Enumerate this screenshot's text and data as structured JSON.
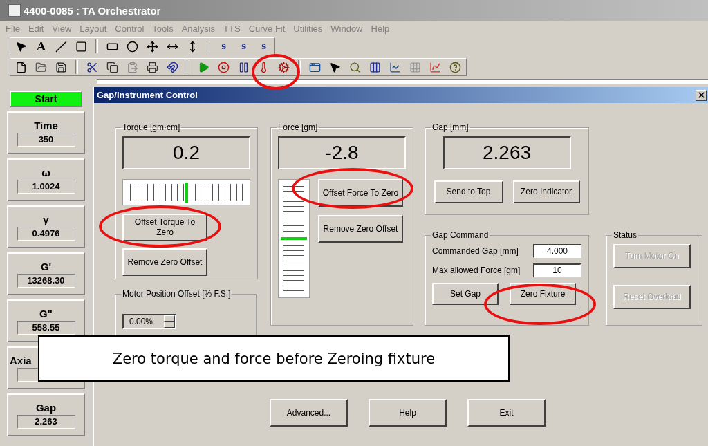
{
  "window": {
    "title": "4400-0085 : TA Orchestrator"
  },
  "menu": [
    "File",
    "Edit",
    "View",
    "Layout",
    "Control",
    "Tools",
    "Analysis",
    "TTS",
    "Curve Fit",
    "Utilities",
    "Window",
    "Help"
  ],
  "toolbars": [
    [
      {
        "kind": "pointer"
      },
      {
        "kind": "text",
        "label": "A"
      },
      {
        "kind": "line"
      },
      {
        "kind": "rectangle"
      },
      {
        "kind": "separator"
      },
      {
        "kind": "rounded-rect"
      },
      {
        "kind": "ellipse"
      },
      {
        "kind": "move"
      },
      {
        "kind": "h-resize"
      },
      {
        "kind": "v-resize"
      },
      {
        "kind": "separator"
      },
      {
        "kind": "style",
        "label": "S"
      },
      {
        "kind": "style",
        "label": "S"
      },
      {
        "kind": "style",
        "label": "S"
      }
    ],
    [
      {
        "kind": "new"
      },
      {
        "kind": "open"
      },
      {
        "kind": "save"
      },
      {
        "kind": "separator"
      },
      {
        "kind": "cut"
      },
      {
        "kind": "copy"
      },
      {
        "kind": "paste"
      },
      {
        "kind": "print"
      },
      {
        "kind": "instrument"
      },
      {
        "kind": "separator"
      },
      {
        "kind": "play"
      },
      {
        "kind": "stop"
      },
      {
        "kind": "pause"
      },
      {
        "kind": "temperature"
      },
      {
        "kind": "gap"
      },
      {
        "kind": "separator"
      },
      {
        "kind": "window"
      },
      {
        "kind": "pointer"
      },
      {
        "kind": "zoom"
      },
      {
        "kind": "columns"
      },
      {
        "kind": "chart"
      },
      {
        "kind": "grid"
      },
      {
        "kind": "curve"
      },
      {
        "kind": "help"
      }
    ]
  ],
  "sidebar": {
    "start_button": "Start",
    "readouts": [
      {
        "label": "Time",
        "value": "350"
      },
      {
        "label": "ω",
        "value": "1.0024"
      },
      {
        "label": "γ",
        "value": "0.4976"
      },
      {
        "label": "G'",
        "value": "13268.30"
      },
      {
        "label": "G\"",
        "value": "558.55"
      },
      {
        "label": "Axia",
        "cut_off": true
      },
      {
        "label": "Gap",
        "value": "2.263"
      }
    ]
  },
  "dialog": {
    "title": "Gap/Instrument Control",
    "torque": {
      "title": "Torque [gm·cm]",
      "reading": "0.2",
      "level": 0.5,
      "buttons": [
        "Offset Torque To Zero",
        "Remove Zero Offset"
      ]
    },
    "motor_offset": {
      "title": "Motor Position Offset [% F.S.]",
      "value": "0.00%"
    },
    "force": {
      "title": "Force [gm]",
      "reading": "-2.8",
      "level": 0.5,
      "buttons": [
        "Offset Force To Zero",
        "Remove Zero Offset"
      ]
    },
    "gap": {
      "title": "Gap [mm]",
      "reading": "2.263",
      "buttons": [
        "Send to Top",
        "Zero Indicator"
      ]
    },
    "gap_command": {
      "title": "Gap Command",
      "fields": [
        {
          "label": "Commanded Gap [mm]",
          "value": "4.000"
        },
        {
          "label": "Max allowed Force [gm]",
          "value": "10"
        }
      ],
      "buttons": [
        "Set Gap",
        "Zero Fixture"
      ]
    },
    "status": {
      "title": "Status",
      "buttons": [
        {
          "label": "Turn Motor On",
          "disabled": true
        },
        {
          "label": "Reset Overload",
          "disabled": true
        }
      ]
    },
    "footer_buttons": [
      "Advanced...",
      "Help",
      "Exit"
    ]
  },
  "caption": "Zero torque and force before Zeroing fixture"
}
